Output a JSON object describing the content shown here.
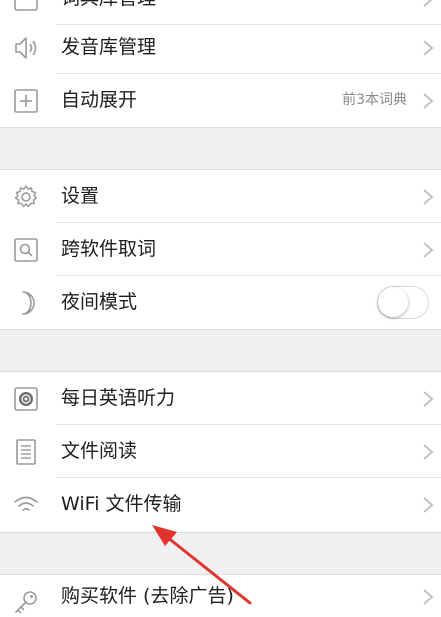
{
  "menu": {
    "group1": [
      {
        "label": "词典库管理",
        "icon": "dictionary-icon"
      },
      {
        "label": "发音库管理",
        "icon": "speaker-icon"
      },
      {
        "label": "自动展开",
        "icon": "plus-square-icon",
        "detail": "前3本词典"
      }
    ],
    "group2": [
      {
        "label": "设置",
        "icon": "gear-icon"
      },
      {
        "label": "跨软件取词",
        "icon": "magnifier-icon"
      },
      {
        "label": "夜间模式",
        "icon": "moon-icon",
        "toggle_on": false
      }
    ],
    "group3": [
      {
        "label": "每日英语听力",
        "icon": "audio-disc-icon"
      },
      {
        "label": "文件阅读",
        "icon": "document-icon"
      },
      {
        "label": "WiFi 文件传输",
        "icon": "wifi-icon"
      }
    ],
    "group4": [
      {
        "label": "购买软件 (去除广告)",
        "icon": "key-icon"
      }
    ]
  },
  "colors": {
    "background": "#f0f0f2",
    "row": "#ffffff",
    "annotation_arrow": "#e0342c",
    "icon": "#9a9a9e",
    "chevron": "#c2c2c6"
  }
}
